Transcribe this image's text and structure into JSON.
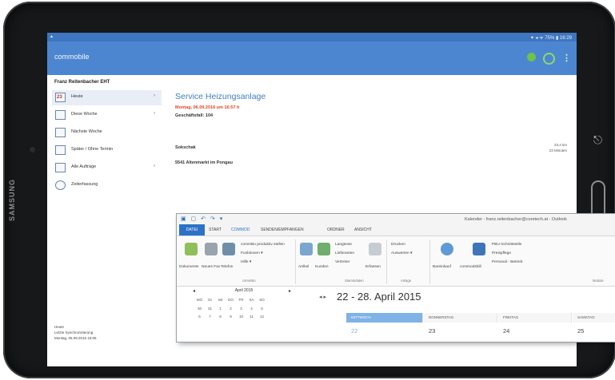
{
  "device": {
    "brand": "SAMSUNG"
  },
  "status_bar": {
    "left": "▴",
    "right": "✦ ◂ ᯤ 75% ▮ 16:29"
  },
  "app": {
    "title": "commobile",
    "accent": "#4c86d0",
    "account": "Franz Reitenbacher EHT",
    "sidebar": [
      {
        "label": "Heute",
        "day": "23",
        "icon": "calendar-today-icon",
        "selected": true,
        "chevron": "›"
      },
      {
        "label": "Diese Woche",
        "icon": "calendar-week-icon",
        "chevron": "›"
      },
      {
        "label": "Nächste Woche",
        "icon": "calendar-next-week-icon",
        "chevron": ""
      },
      {
        "label": "Später / Ohne Termin",
        "icon": "calendar-later-icon",
        "chevron": ""
      },
      {
        "label": "Alle Aufträge",
        "icon": "list-icon",
        "chevron": "›"
      },
      {
        "label": "Zeiterfassung",
        "icon": "search-clock-icon",
        "chevron": ""
      }
    ],
    "footer": [
      "Heute",
      "Letzte Synchronisierung",
      "Montag, 06.09.2016 16:06"
    ],
    "detail": {
      "title": "Service Heizungsanlage",
      "datetime": "Montag, 06.09.2016 um 16:57 h",
      "case": "Geschäftsfall: 104",
      "customer": "Sokschak",
      "city": "5541 Altenmarkt im Pongau",
      "distance_km": "23,4 km",
      "duration": "23 Minuten"
    }
  },
  "outlook": {
    "quick_access": "▣ ▢ ↶ ↷ ▾",
    "window_title": "Kalender - franz.reitenbacher@coretech.at - Outlook",
    "tabs": [
      "DATEI",
      "START",
      "COMMOD",
      "SENDEN/EMPFANGEN",
      "ORDNER",
      "ANSICHT"
    ],
    "ribbon": {
      "buttons": [
        {
          "label": "Dokumente",
          "icon": "documents-icon"
        },
        {
          "label": "Neues Fax",
          "icon": "fax-icon"
        },
        {
          "label": "Telefon",
          "icon": "phone-icon"
        },
        {
          "label": "Artikel",
          "icon": "tag-icon"
        },
        {
          "label": "Kunden",
          "icon": "customer-icon"
        },
        {
          "label": "Erfassen",
          "icon": "capture-icon"
        },
        {
          "label": "Bareinkauf",
          "icon": "cash-icon"
        },
        {
          "label": "commodsbill",
          "icon": "bill-icon"
        }
      ],
      "small": [
        "commBo produktiv stellen",
        "Funktionen ▾",
        "Hilfe ▾",
        "Langtexte",
        "Lieferanten",
        "Vertreter",
        "Drucken",
        "Auswerten ▾",
        "PBU-Schnittstelle",
        "Preispflege",
        "Personal - Betrieb"
      ],
      "groups": [
        "commBo",
        "Stammdaten",
        "Anlage",
        "Module"
      ]
    },
    "mini_calendar": {
      "month": "April 2015",
      "weekdays": [
        "MO",
        "DI",
        "MI",
        "DO",
        "FR",
        "SA",
        "SO"
      ],
      "rows": [
        [
          "30",
          "31",
          "1",
          "2",
          "3",
          "4",
          "5"
        ],
        [
          "6",
          "7",
          "8",
          "9",
          "10",
          "11",
          "12"
        ]
      ]
    },
    "calendar": {
      "range": "22 - 28. April 2015",
      "days": [
        {
          "name": "MITTWOCH",
          "num": "22",
          "today": true
        },
        {
          "name": "DONNERSTAG",
          "num": "23"
        },
        {
          "name": "FREITAG",
          "num": "24"
        },
        {
          "name": "SAMSTAG",
          "num": "25"
        }
      ]
    }
  }
}
